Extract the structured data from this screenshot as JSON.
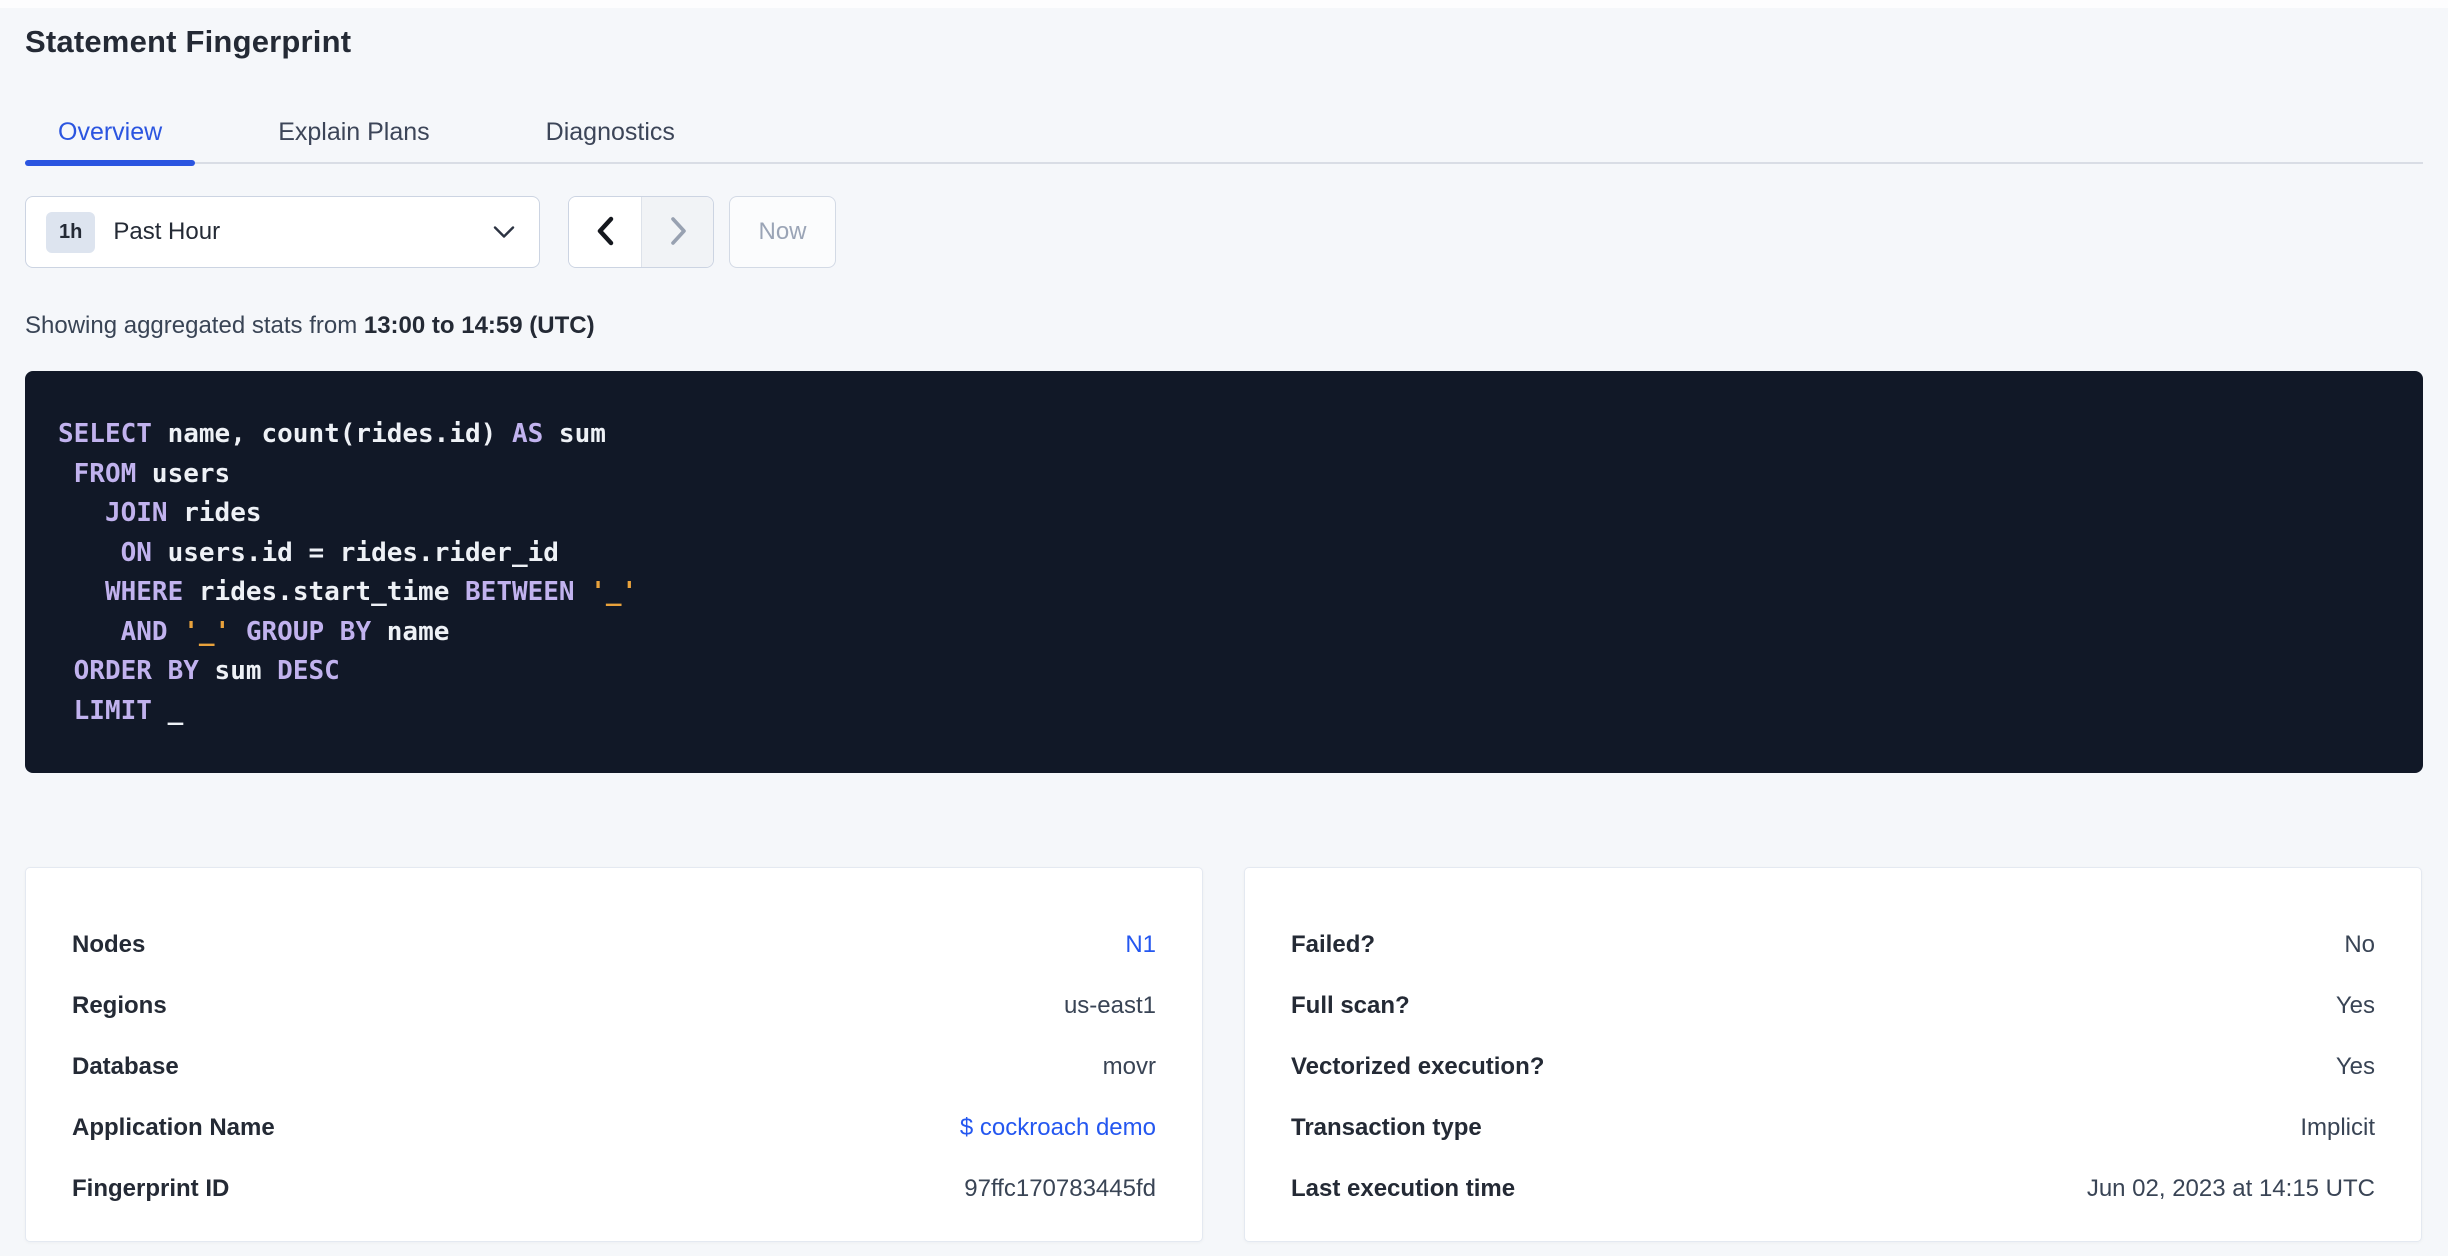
{
  "page": {
    "title": "Statement Fingerprint"
  },
  "tabs": [
    {
      "label": "Overview",
      "active": true
    },
    {
      "label": "Explain Plans",
      "active": false
    },
    {
      "label": "Diagnostics",
      "active": false
    }
  ],
  "time_picker": {
    "interval_badge": "1h",
    "interval_label": "Past Hour",
    "now_label": "Now",
    "icons": {
      "dropdown": "chevron-down",
      "prev": "chevron-left",
      "next": "chevron-right"
    },
    "next_disabled": true
  },
  "stats_line": {
    "prefix": "Showing aggregated stats from ",
    "range_bold": "13:00 to 14:59 (UTC)"
  },
  "sql": {
    "lines": [
      [
        {
          "type": "keyword",
          "text": "SELECT"
        },
        {
          "type": "plain",
          "text": " name, count(rides.id) "
        },
        {
          "type": "keyword",
          "text": "AS"
        },
        {
          "type": "plain",
          "text": " sum"
        }
      ],
      [
        {
          "type": "plain",
          "text": " "
        },
        {
          "type": "keyword",
          "text": "FROM"
        },
        {
          "type": "plain",
          "text": " users"
        }
      ],
      [
        {
          "type": "plain",
          "text": "   "
        },
        {
          "type": "keyword",
          "text": "JOIN"
        },
        {
          "type": "plain",
          "text": " rides"
        }
      ],
      [
        {
          "type": "plain",
          "text": "    "
        },
        {
          "type": "keyword",
          "text": "ON"
        },
        {
          "type": "plain",
          "text": " users.id = rides.rider_id"
        }
      ],
      [
        {
          "type": "plain",
          "text": "   "
        },
        {
          "type": "keyword",
          "text": "WHERE"
        },
        {
          "type": "plain",
          "text": " rides.start_time "
        },
        {
          "type": "keyword",
          "text": "BETWEEN"
        },
        {
          "type": "plain",
          "text": " "
        },
        {
          "type": "string",
          "text": "'_'"
        }
      ],
      [
        {
          "type": "plain",
          "text": "    "
        },
        {
          "type": "keyword",
          "text": "AND"
        },
        {
          "type": "plain",
          "text": " "
        },
        {
          "type": "string",
          "text": "'_'"
        },
        {
          "type": "plain",
          "text": " "
        },
        {
          "type": "keyword",
          "text": "GROUP BY"
        },
        {
          "type": "plain",
          "text": " name"
        }
      ],
      [
        {
          "type": "plain",
          "text": " "
        },
        {
          "type": "keyword",
          "text": "ORDER BY"
        },
        {
          "type": "plain",
          "text": " sum "
        },
        {
          "type": "keyword",
          "text": "DESC"
        }
      ],
      [
        {
          "type": "plain",
          "text": " "
        },
        {
          "type": "keyword",
          "text": "LIMIT"
        },
        {
          "type": "plain",
          "text": " _"
        }
      ]
    ]
  },
  "cards": {
    "left": {
      "rows": [
        {
          "label": "Nodes",
          "value": "N1",
          "link": true
        },
        {
          "label": "Regions",
          "value": "us-east1",
          "link": false
        },
        {
          "label": "Database",
          "value": "movr",
          "link": false
        },
        {
          "label": "Application Name",
          "value": "$ cockroach demo",
          "link": true
        },
        {
          "label": "Fingerprint ID",
          "value": "97ffc170783445fd",
          "link": false
        }
      ]
    },
    "right": {
      "rows": [
        {
          "label": "Failed?",
          "value": "No"
        },
        {
          "label": "Full scan?",
          "value": "Yes"
        },
        {
          "label": "Vectorized execution?",
          "value": "Yes"
        },
        {
          "label": "Transaction type",
          "value": "Implicit"
        },
        {
          "label": "Last execution time",
          "value": "Jun 02, 2023 at 14:15 UTC"
        }
      ]
    }
  },
  "colors": {
    "page_background": "#f5f7fa",
    "accent_blue": "#2b55e0",
    "link_blue": "#2457f0",
    "sql_background": "#111827",
    "sql_keyword": "#c1b2ee",
    "sql_plain": "#eef1f6",
    "sql_string": "#e9a23c"
  }
}
